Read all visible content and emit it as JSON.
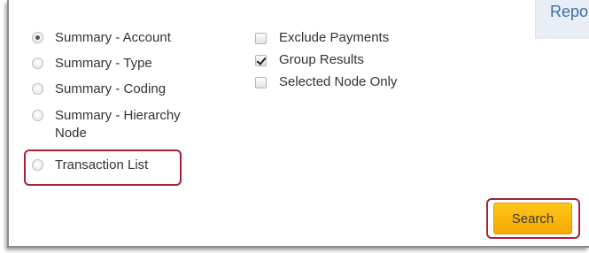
{
  "report_tab": {
    "label": "Repo"
  },
  "report_types": [
    {
      "label": "Summary - Account",
      "selected": true
    },
    {
      "label": "Summary - Type",
      "selected": false
    },
    {
      "label": "Summary - Coding",
      "selected": false
    },
    {
      "label": "Summary - Hierarchy Node",
      "selected": false
    },
    {
      "label": "Transaction List",
      "selected": false
    }
  ],
  "options": [
    {
      "label": "Exclude Payments",
      "checked": false
    },
    {
      "label": "Group Results",
      "checked": true
    },
    {
      "label": "Selected Node Only",
      "checked": false
    }
  ],
  "search_button": {
    "label": "Search"
  },
  "colors": {
    "highlight": "#a8203a",
    "button": "#f5b400",
    "tab_text": "#3f6fa5"
  }
}
